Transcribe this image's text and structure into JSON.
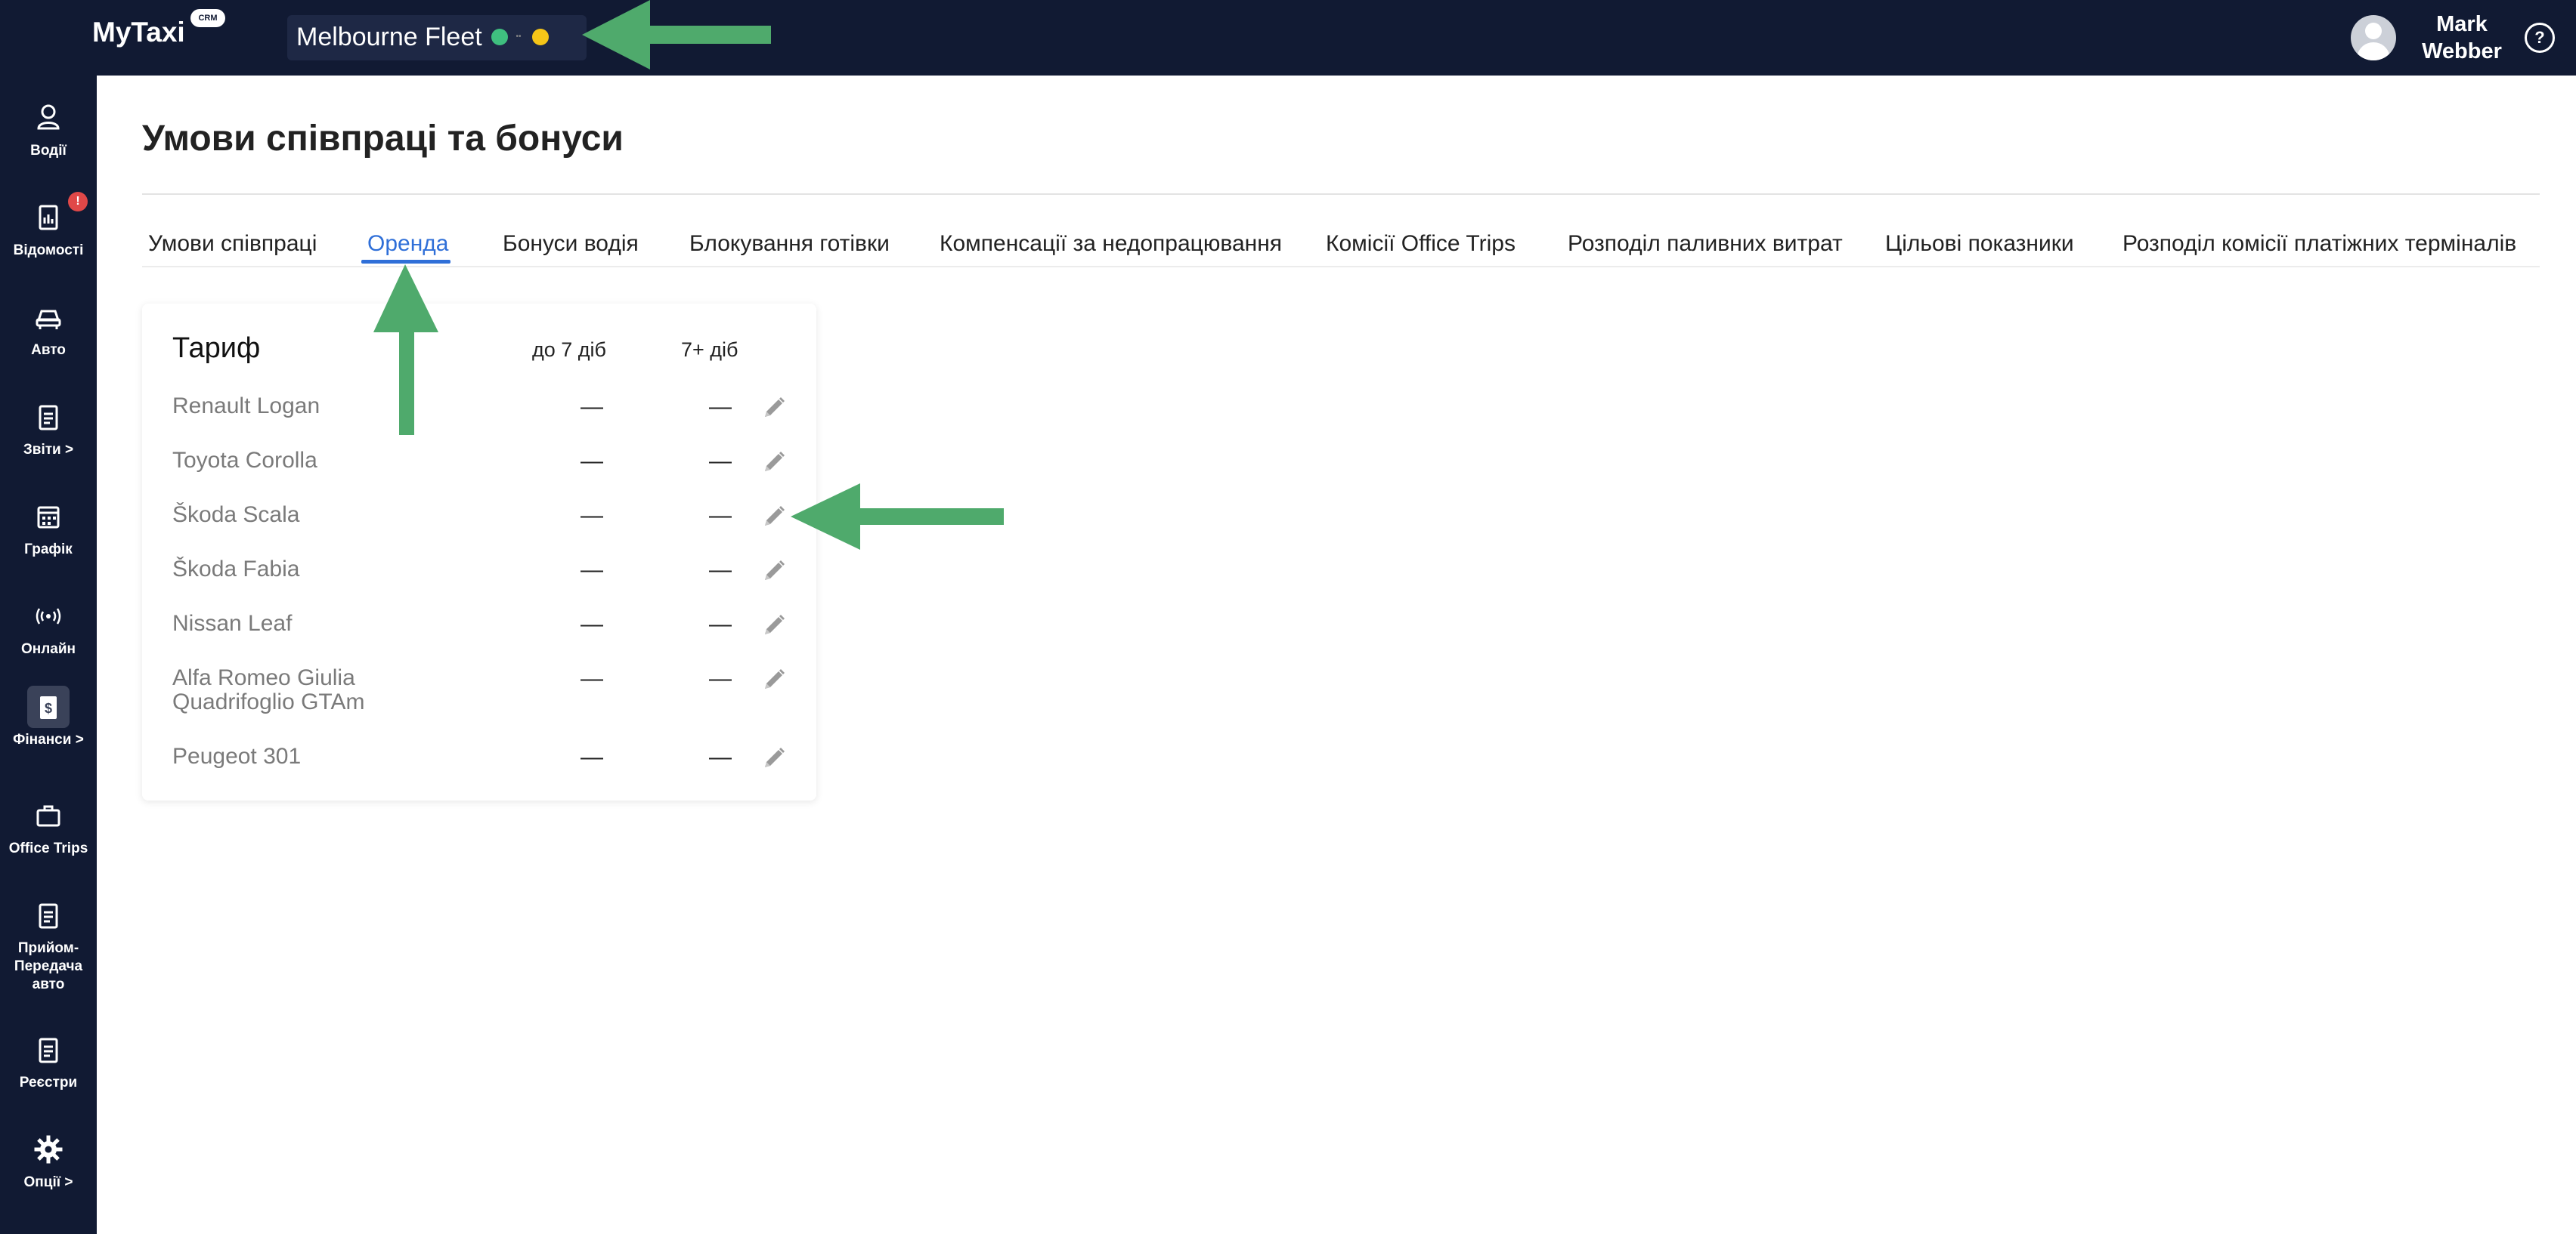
{
  "app": {
    "logo_text": "MyTaxi",
    "logo_badge": "CRM",
    "fleet_name": "Melbourne Fleet",
    "fleet_mid_label": "••",
    "user_name": "Mark Webber"
  },
  "sidebar": {
    "items": [
      {
        "label": "Водії",
        "icon": "driver-icon"
      },
      {
        "label": "Відомості",
        "icon": "report-icon",
        "badge": "!"
      },
      {
        "label": "Авто",
        "icon": "car-icon"
      },
      {
        "label": "Звіти >",
        "icon": "clipboard-icon"
      },
      {
        "label": "Графік",
        "icon": "calendar-icon"
      },
      {
        "label": "Онлайн",
        "icon": "online-icon"
      },
      {
        "label": "Фінанси >",
        "icon": "finance-icon",
        "active": true
      },
      {
        "label": "Office Trips",
        "icon": "briefcase-icon"
      },
      {
        "label": "Прийом-Передача авто",
        "icon": "handover-icon"
      },
      {
        "label": "Реєстри",
        "icon": "registry-icon"
      },
      {
        "label": "Опції >",
        "icon": "gear-icon"
      }
    ]
  },
  "page": {
    "title": "Умови співпраці та бонуси"
  },
  "tabs": [
    {
      "label": "Умови співпраці"
    },
    {
      "label": "Оренда",
      "active": true
    },
    {
      "label": "Бонуси водія"
    },
    {
      "label": "Блокування готівки"
    },
    {
      "label": "Компенсації за недопрацювання"
    },
    {
      "label": "Комісії Office Trips"
    },
    {
      "label": "Розподіл паливних витрат"
    },
    {
      "label": "Цільові показники"
    },
    {
      "label": "Розподіл комісії платіжних терміналів"
    }
  ],
  "rent_table": {
    "header": {
      "tariff": "Тариф",
      "col1": "до 7 діб",
      "col2": "7+ діб"
    },
    "rows": [
      {
        "name": "Renault Logan",
        "v1": "—",
        "v2": "—"
      },
      {
        "name": "Toyota Corolla",
        "v1": "—",
        "v2": "—"
      },
      {
        "name": "Škoda Scala",
        "v1": "—",
        "v2": "—"
      },
      {
        "name": "Škoda Fabia",
        "v1": "—",
        "v2": "—"
      },
      {
        "name": "Nissan Leaf",
        "v1": "—",
        "v2": "—"
      },
      {
        "name": "Alfa Romeo Giulia Quadrifoglio GTAm",
        "v1": "—",
        "v2": "—"
      },
      {
        "name": "Peugeot 301",
        "v1": "—",
        "v2": "—"
      }
    ]
  },
  "colors": {
    "nav_bg": "#111a33",
    "accent": "#2f6fd8",
    "annotation_arrow": "#4faa6c",
    "badge": "#e04848"
  }
}
